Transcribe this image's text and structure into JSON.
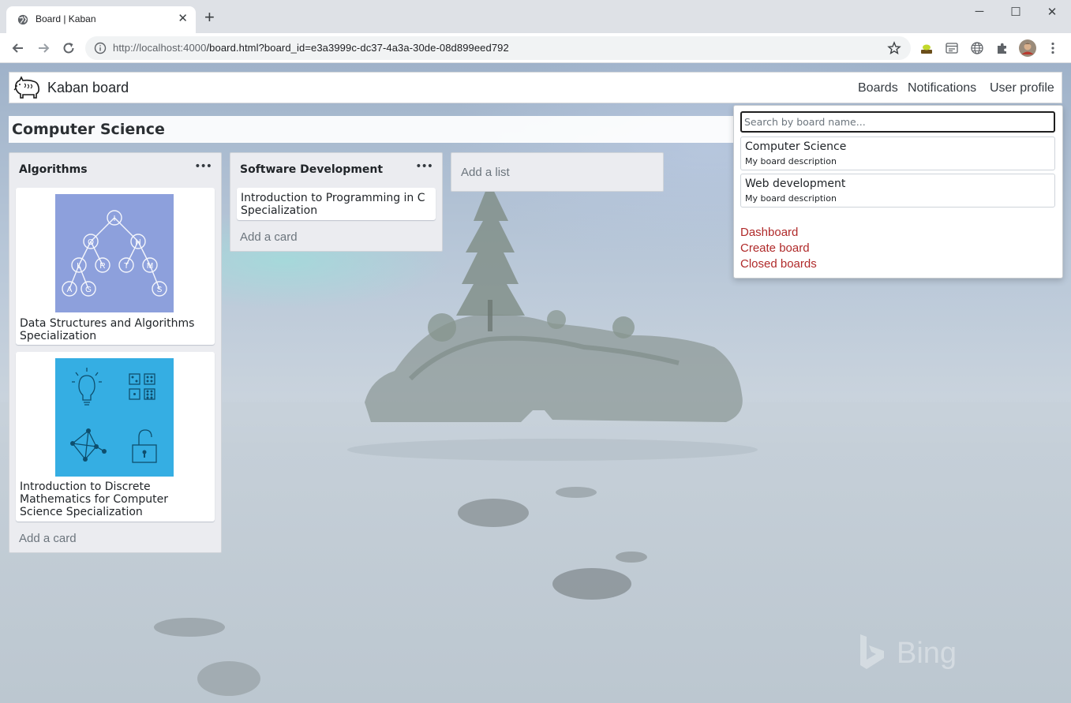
{
  "browser": {
    "tab_title": "Board | Kaban",
    "tab_close": "✕",
    "new_tab": "+",
    "url_host": "http://localhost:4000",
    "url_path": "/board.html?board_id=e3a3999c-dc37-4a3a-30de-08d899eed792",
    "window_controls": {
      "minimize": "─",
      "maximize": "☐",
      "close": "✕"
    }
  },
  "navbar": {
    "brand": "Kaban board",
    "links": [
      "Boards",
      "Notifications",
      "User profile"
    ]
  },
  "board": {
    "title": "Computer Science",
    "lists": [
      {
        "title": "Algorithms",
        "menu": "•••",
        "cards": [
          {
            "text": "Data Structures and Algorithms Specialization",
            "image": "tree-diagram"
          },
          {
            "text": "Introduction to Discrete Mathematics for Computer Science Specialization",
            "image": "discrete-math-icons"
          }
        ],
        "add_card": "Add a card"
      },
      {
        "title": "Software Development",
        "menu": "•••",
        "cards": [
          {
            "text": "Introduction to Programming in C Specialization"
          }
        ],
        "add_card": "Add a card"
      }
    ],
    "add_list": "Add a list"
  },
  "dropdown": {
    "search_placeholder": "Search by board name...",
    "boards": [
      {
        "name": "Computer Science",
        "description": "My board description"
      },
      {
        "name": "Web development",
        "description": "My board description"
      }
    ],
    "links": [
      "Dashboard",
      "Create board",
      "Closed boards"
    ]
  },
  "watermark": "Bing",
  "algo_tree_nodes": [
    "I",
    "O",
    "H",
    "L",
    "R",
    "T",
    "M",
    "A",
    "G",
    "S"
  ],
  "colors": {
    "algo_image": "#8da0dc",
    "discrete_image": "#35aee3",
    "dropdown_link": "#b02a2a"
  }
}
